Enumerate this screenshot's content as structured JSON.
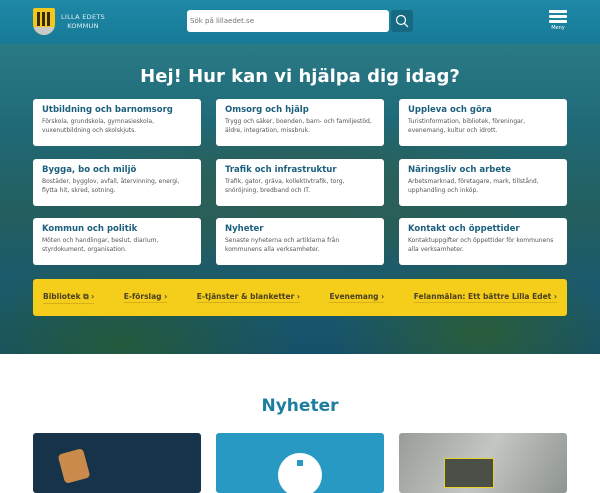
{
  "header": {
    "logo_line1": "LILLA EDETS",
    "logo_line2": "KOMMUN",
    "search_placeholder": "Sök på lillaedet.se",
    "menu_label": "Meny"
  },
  "hero": {
    "title": "Hej! Hur kan vi hjälpa dig idag?",
    "cards": [
      {
        "title": "Utbildning och barnomsorg",
        "desc": "Förskola, grundskola, gymnasieskola, vuxenutbildning och skolskjuts."
      },
      {
        "title": "Omsorg och hjälp",
        "desc": "Trygg och säker, boenden, barn- och familjestöd, äldre, integration, missbruk."
      },
      {
        "title": "Uppleva och göra",
        "desc": "Turistinformation, bibliotek, föreningar, evenemang, kultur och idrott."
      },
      {
        "title": "Bygga, bo och miljö",
        "desc": "Bostäder, bygglov, avfall, återvinning, energi, flytta hit, skred, sotning."
      },
      {
        "title": "Trafik och infrastruktur",
        "desc": "Trafik, gator, gräva, kollektivtrafik, torg, snöröjning, bredband och IT."
      },
      {
        "title": "Näringsliv och arbete",
        "desc": "Arbetsmarknad, företagare, mark, tillstånd, upphandling och inköp."
      },
      {
        "title": "Kommun och politik",
        "desc": "Möten och handlingar, beslut, diarium, styrdokument, organisation."
      },
      {
        "title": "Nyheter",
        "desc": "Senaste nyheterna och artiklarna från kommunens alla verksamheter."
      },
      {
        "title": "Kontakt och öppettider",
        "desc": "Kontaktuppgifter och öppettider för kommunens alla verksamheter."
      }
    ]
  },
  "quick_links": [
    "Bibliotek ⧉ ›",
    "E-förslag ›",
    "E-tjänster & blanketter ›",
    "Evenemang ›",
    "Felanmälan: Ett bättre Lilla Edet ›"
  ],
  "news": {
    "title": "Nyheter"
  }
}
